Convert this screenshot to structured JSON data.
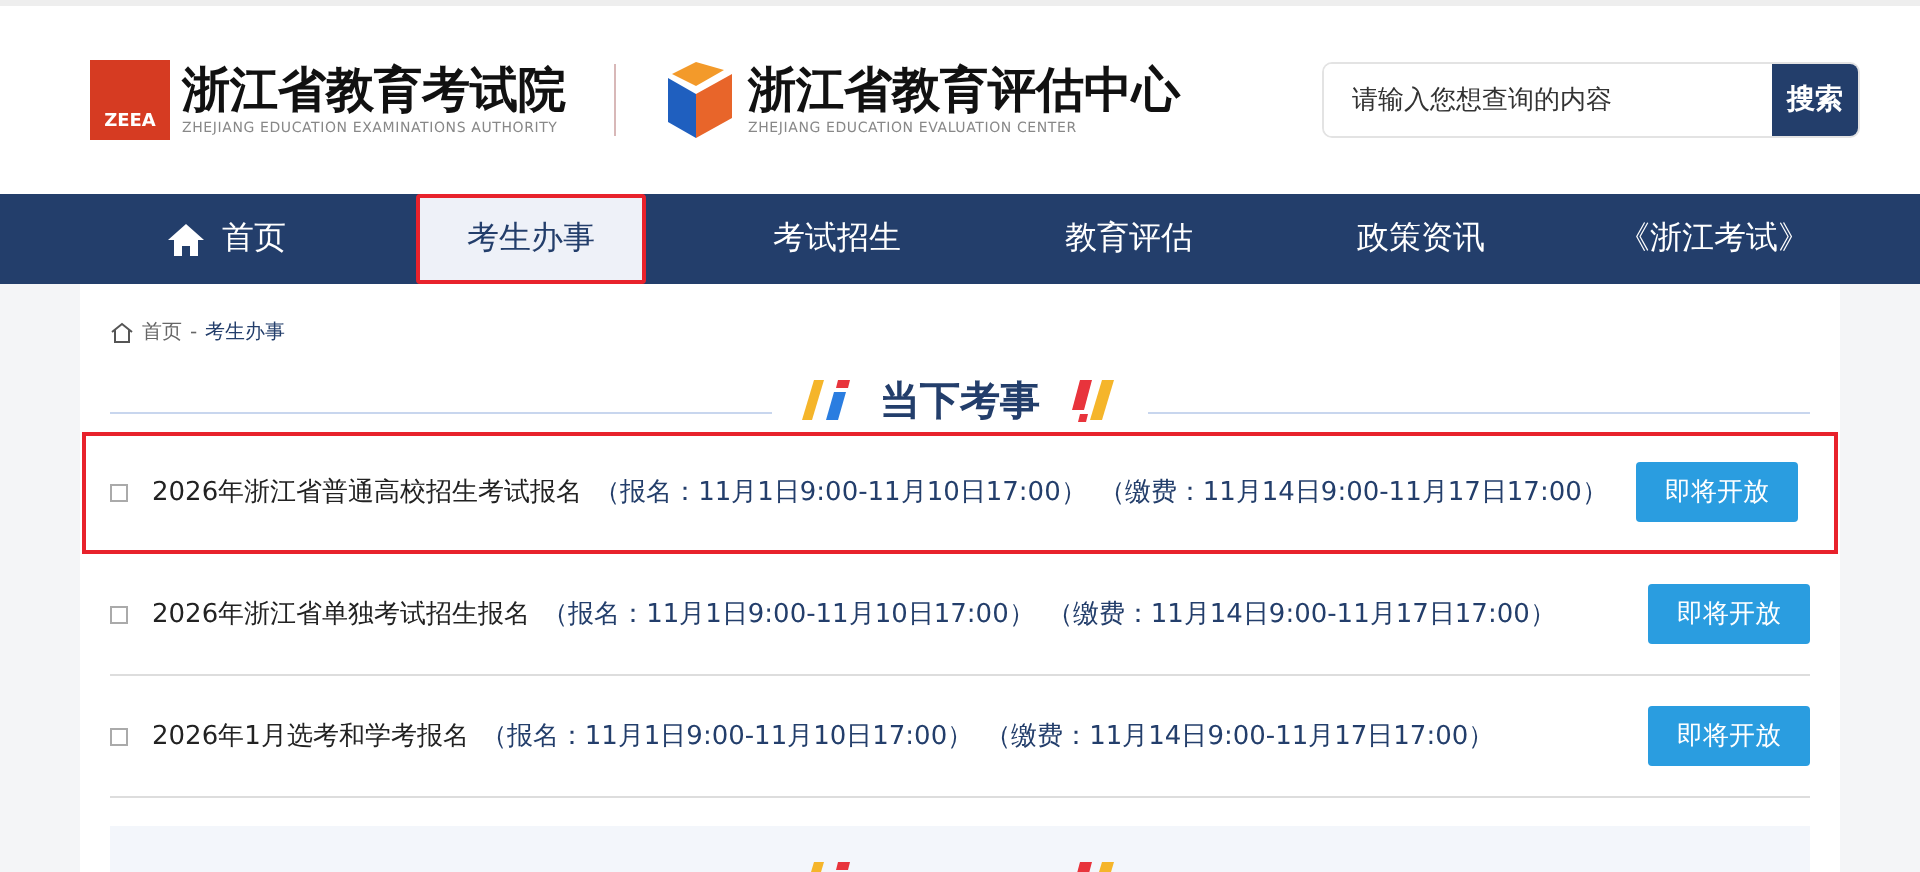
{
  "header": {
    "logo_left": {
      "badge": "ZEEA",
      "name": "浙江省教育考试院",
      "subtitle": "ZHEJIANG EDUCATION EXAMINATIONS AUTHORITY"
    },
    "logo_right": {
      "name": "浙江省教育评估中心",
      "subtitle": "ZHEJIANG EDUCATION EVALUATION CENTER"
    },
    "search": {
      "placeholder": "请输入您想查询的内容",
      "button": "搜索"
    }
  },
  "nav": [
    {
      "label": "首页",
      "kind": "home",
      "selected": false,
      "highlighted": false
    },
    {
      "label": "考生办事",
      "kind": "text",
      "selected": true,
      "highlighted": true
    },
    {
      "label": "考试招生",
      "kind": "text",
      "selected": false,
      "highlighted": false
    },
    {
      "label": "教育评估",
      "kind": "text",
      "selected": false,
      "highlighted": false
    },
    {
      "label": "政策资讯",
      "kind": "text",
      "selected": false,
      "highlighted": false
    },
    {
      "label": "《浙江考试》",
      "kind": "text",
      "selected": false,
      "highlighted": false
    }
  ],
  "breadcrumb": {
    "items": [
      "首页",
      "考生办事"
    ],
    "separator": "-"
  },
  "section_title": "当下考事",
  "items": [
    {
      "title": "2026年浙江省普通高校招生考试报名",
      "signup": "（报名：11月1日9:00-11月10日17:00）",
      "payment": "（缴费：11月14日9:00-11月17日17:00）",
      "button": "即将开放",
      "highlighted": true
    },
    {
      "title": "2026年浙江省单独考试招生报名",
      "signup": "（报名：11月1日9:00-11月10日17:00）",
      "payment": "（缴费：11月14日9:00-11月17日17:00）",
      "button": "即将开放",
      "highlighted": false
    },
    {
      "title": "2026年1月选考和学考报名",
      "signup": "（报名：11月1日9:00-11月10日17:00）",
      "payment": "（缴费：11月14日9:00-11月17日17:00）",
      "button": "即将开放",
      "highlighted": false
    }
  ]
}
